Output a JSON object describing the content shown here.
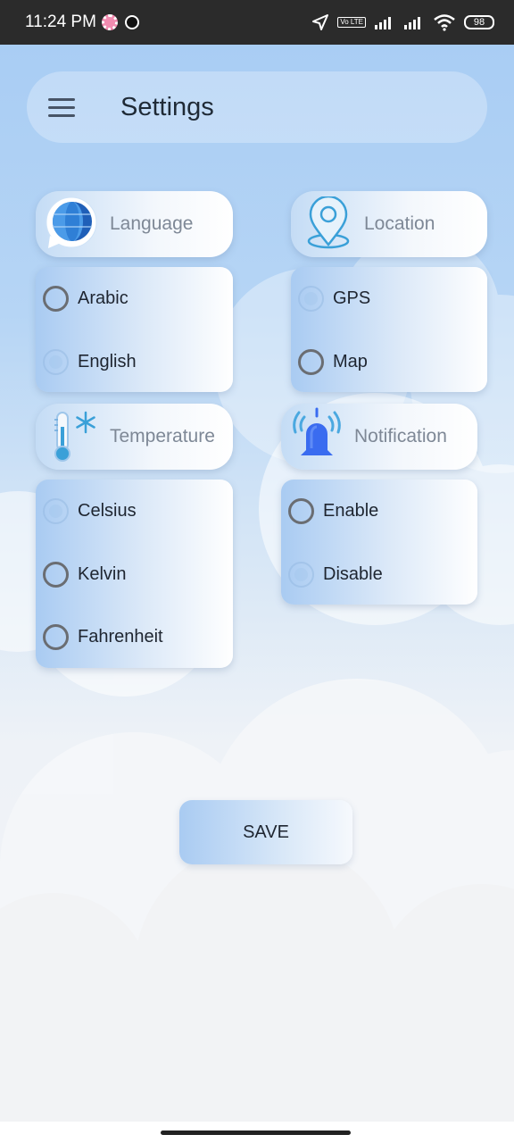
{
  "status_bar": {
    "time": "11:24 PM",
    "battery": "98",
    "volte": "Vo LTE",
    "icons": [
      "notification-app-icon",
      "notification-m-icon",
      "location-arrow-icon",
      "volte-icon",
      "signal-icon",
      "signal-icon",
      "wifi-icon",
      "battery-icon"
    ]
  },
  "header": {
    "menu_icon": "hamburger-menu-icon",
    "title": "Settings"
  },
  "sections": {
    "language": {
      "label": "Language",
      "icon": "globe-chat-icon",
      "options": [
        "Arabic",
        "English"
      ],
      "selected": "English"
    },
    "location": {
      "label": "Location",
      "icon": "map-pin-icon",
      "options": [
        "GPS",
        "Map"
      ],
      "selected": "GPS"
    },
    "temperature": {
      "label": "Temperature",
      "icon": "thermometer-snowflake-icon",
      "options": [
        "Celsius",
        "Kelvin",
        "Fahrenheit"
      ],
      "selected": "Celsius"
    },
    "notification": {
      "label": "Notification",
      "icon": "bell-ringing-icon",
      "options": [
        "Enable",
        "Disable"
      ],
      "selected": "Disable"
    }
  },
  "save_label": "SAVE",
  "colors": {
    "sky_top": "#a9cdf4",
    "card_left": "#a9cbf2",
    "title_text": "#1f2a36",
    "bell_blue": "#3a6cf0"
  }
}
